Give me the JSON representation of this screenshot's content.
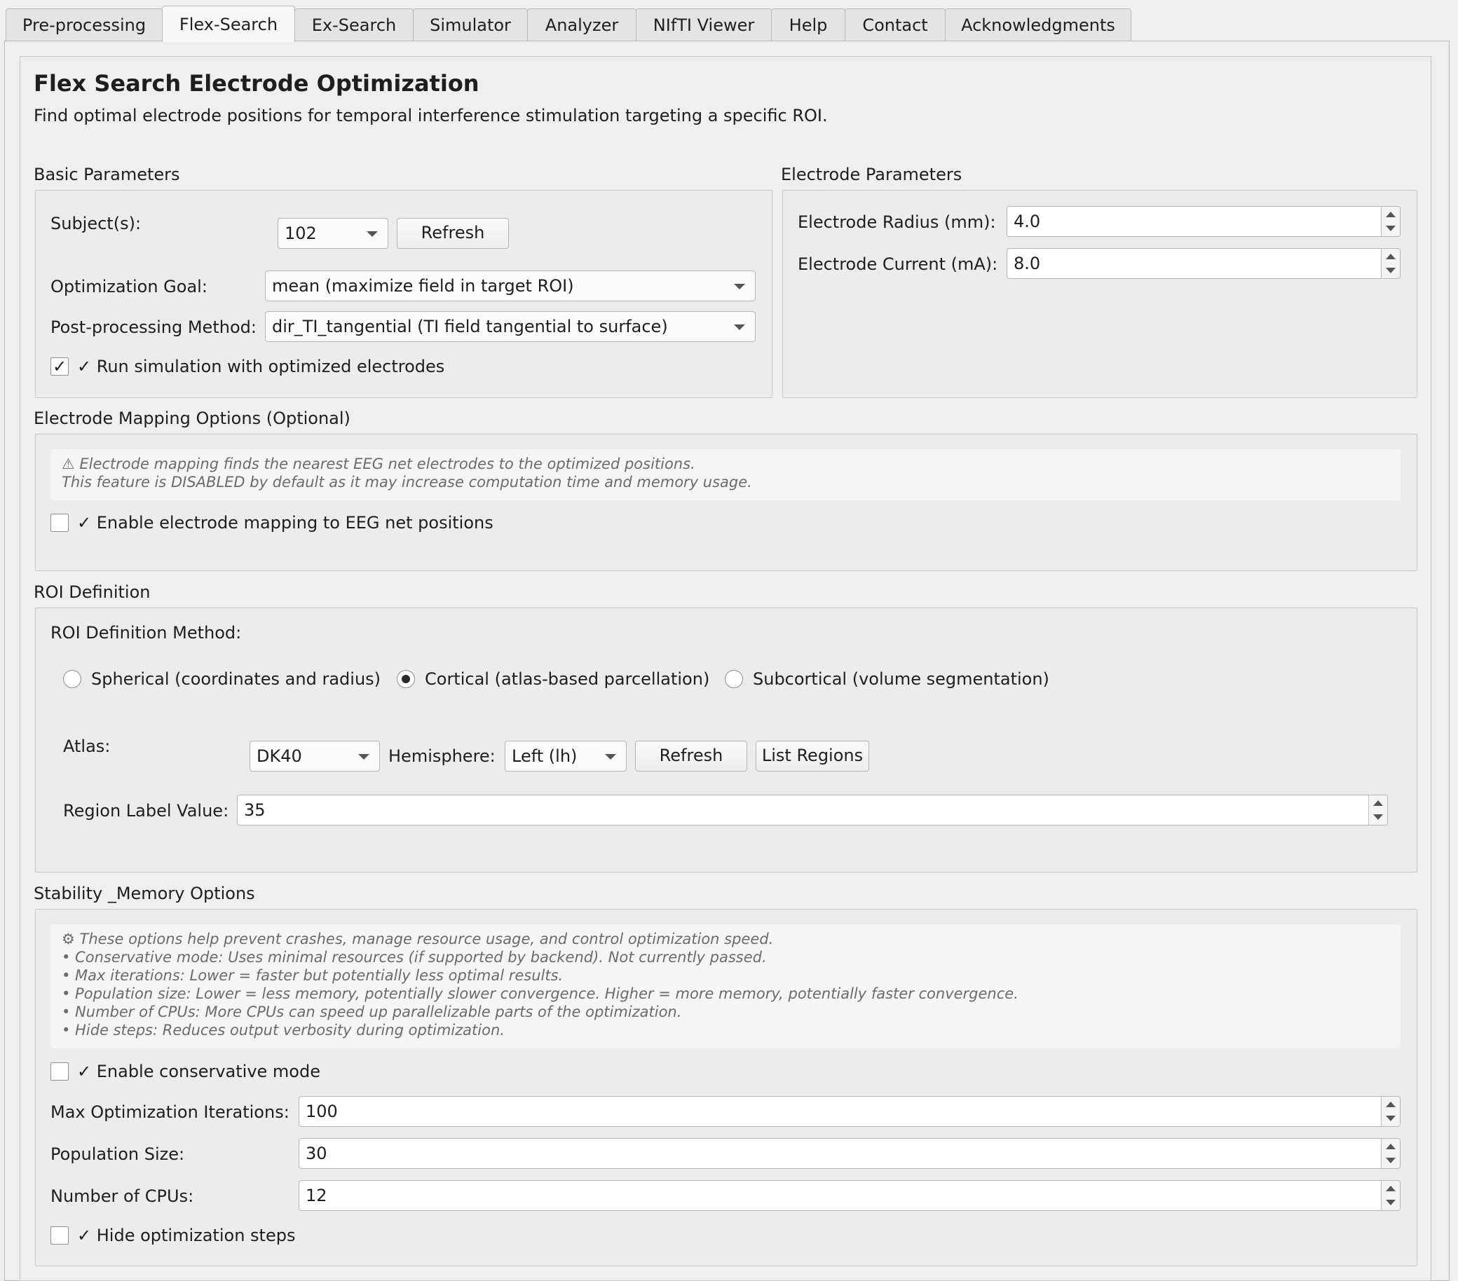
{
  "tabs": [
    "Pre-processing",
    "Flex-Search",
    "Ex-Search",
    "Simulator",
    "Analyzer",
    "NIfTI Viewer",
    "Help",
    "Contact",
    "Acknowledgments"
  ],
  "header": {
    "title": "Flex Search Electrode Optimization",
    "subtitle": "Find optimal electrode positions for temporal interference stimulation targeting a specific ROI."
  },
  "basic": {
    "title": "Basic Parameters",
    "subjects_label": "Subject(s):",
    "subject_value": "102",
    "refresh_label": "Refresh",
    "goal_label": "Optimization Goal:",
    "goal_value": "mean (maximize field in target ROI)",
    "post_label": "Post-processing Method:",
    "post_value": "dir_TI_tangential (TI field tangential to surface)",
    "run_sim_label": "✓ Run simulation with optimized electrodes",
    "run_sim_checked": "✓"
  },
  "electrode": {
    "title": "Electrode Parameters",
    "radius_label": "Electrode Radius (mm):",
    "radius_value": "4.0",
    "current_label": "Electrode Current (mA):",
    "current_value": "8.0"
  },
  "mapping": {
    "title": "Electrode Mapping Options (Optional)",
    "note": "⚠ Electrode mapping finds the nearest EEG net electrodes to the optimized positions.\nThis feature is DISABLED by default as it may increase computation time and memory usage.",
    "enable_label": "✓ Enable electrode mapping to EEG net positions"
  },
  "roi": {
    "title": "ROI Definition",
    "method_label": "ROI Definition Method:",
    "spherical_label": "Spherical (coordinates and radius)",
    "cortical_label": "Cortical (atlas-based parcellation)",
    "subcortical_label": "Subcortical (volume segmentation)",
    "atlas_label": "Atlas:",
    "atlas_value": "DK40",
    "hemisphere_label": "Hemisphere:",
    "hemisphere_value": "Left (lh)",
    "refresh_label": "Refresh",
    "list_regions_label": "List Regions",
    "region_label": "Region Label Value:",
    "region_value": "35"
  },
  "stability": {
    "title": "Stability _Memory Options",
    "note": "⚙ These options help prevent crashes, manage resource usage, and control optimization speed.\n• Conservative mode: Uses minimal resources (if supported by backend). Not currently passed.\n• Max iterations: Lower = faster but potentially less optimal results.\n• Population size: Lower = less memory, potentially slower convergence. Higher = more memory, potentially faster convergence.\n• Number of CPUs: More CPUs can speed up parallelizable parts of the optimization.\n• Hide steps: Reduces output verbosity during optimization.",
    "conservative_label": "✓ Enable conservative mode",
    "iterations_label": "Max Optimization Iterations:",
    "iterations_value": "100",
    "population_label": "Population Size:",
    "population_value": "30",
    "cpus_label": "Number of CPUs:",
    "cpus_value": "12",
    "hide_steps_label": "✓ Hide optimization steps"
  }
}
